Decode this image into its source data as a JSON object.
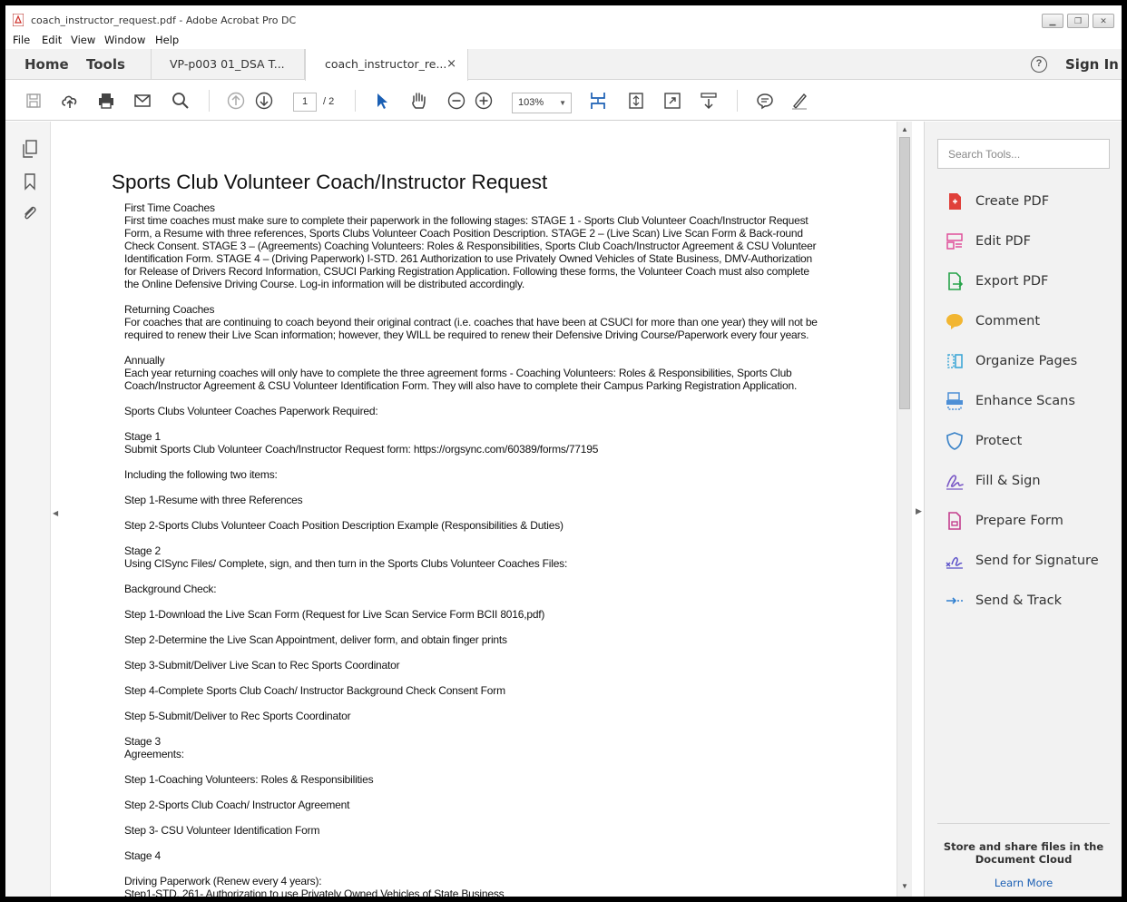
{
  "window": {
    "title": "coach_instructor_request.pdf - Adobe Acrobat Pro DC"
  },
  "menu": [
    "File",
    "Edit",
    "View",
    "Window",
    "Help"
  ],
  "tabs": {
    "home": "Home",
    "tools": "Tools",
    "docs": [
      {
        "label": "VP-p003 01_DSA T..."
      },
      {
        "label": "coach_instructor_re...",
        "close": "×"
      }
    ],
    "sign_in": "Sign In",
    "help": "?"
  },
  "toolbar": {
    "page_current": "1",
    "page_total": "/ 2",
    "zoom": "103%",
    "zoom_caret": "▼"
  },
  "document": {
    "title": "Sports Club Volunteer Coach/Instructor Request",
    "paragraphs": [
      [
        "First Time Coaches",
        "First time coaches must make sure to complete their paperwork in the following stages: STAGE 1 - Sports Club Volunteer Coach/Instructor Request",
        "Form, a Resume with three references, Sports Clubs Volunteer Coach Position Description.  STAGE 2 – (Live Scan) Live Scan Form & Back-round",
        "Check Consent.  STAGE 3 – (Agreements) Coaching Volunteers: Roles & Responsibilities, Sports Club Coach/Instructor Agreement & CSU Volunteer",
        "Identification Form.  STAGE 4 – (Driving Paperwork) I-STD. 261 Authorization to use Privately Owned Vehicles of State Business, DMV-Authorization",
        "for Release of Drivers Record Information, CSUCI Parking Registration Application.  Following these forms, the Volunteer Coach must also complete",
        "the Online Defensive Driving Course.  Log-in information will be distributed accordingly."
      ],
      [
        "Returning Coaches",
        "For coaches that are continuing to coach beyond their original contract (i.e. coaches that have been at CSUCI for more than one year) they will not be",
        "required to renew their Live Scan information; however, they WILL be required to renew their Defensive Driving Course/Paperwork every four years."
      ],
      [
        "Annually",
        "Each year returning coaches will only have to complete the three agreement forms -   Coaching Volunteers: Roles & Responsibilities, Sports Club",
        "Coach/Instructor Agreement & CSU Volunteer Identification Form.  They will also have to complete their Campus Parking Registration Application."
      ],
      [
        "Sports Clubs Volunteer Coaches Paperwork Required:"
      ],
      [
        "Stage 1",
        "Submit Sports Club Volunteer Coach/Instructor Request form: https://orgsync.com/60389/forms/77195"
      ],
      [
        "Including the following two items:"
      ],
      [
        "Step 1-Resume with three References"
      ],
      [
        "Step 2-Sports Clubs Volunteer Coach Position Description Example (Responsibilities & Duties)"
      ],
      [
        "Stage 2",
        "Using CISync Files/ Complete, sign, and then turn in the Sports Clubs Volunteer Coaches Files:"
      ],
      [
        "Background Check:"
      ],
      [
        "Step 1-Download the Live Scan Form (Request for Live Scan Service Form BCII 8016,pdf)"
      ],
      [
        "Step 2-Determine the Live Scan Appointment, deliver form, and obtain finger prints"
      ],
      [
        "Step 3-Submit/Deliver Live Scan to Rec Sports Coordinator"
      ],
      [
        "Step 4-Complete Sports Club Coach/ Instructor Background Check Consent Form"
      ],
      [
        "Step 5-Submit/Deliver to Rec Sports Coordinator"
      ],
      [
        "Stage 3",
        "Agreements:"
      ],
      [
        "Step 1-Coaching Volunteers: Roles & Responsibilities"
      ],
      [
        "Step 2-Sports Club Coach/ Instructor Agreement"
      ],
      [
        "Step 3- CSU Volunteer Identification Form"
      ],
      [
        "Stage 4"
      ],
      [
        "Driving Paperwork (Renew every 4 years):",
        "Step1-STD. 261- Authorization to use Privately Owned Vehicles of State Business"
      ]
    ]
  },
  "tools_pane": {
    "search_placeholder": "Search Tools...",
    "items": [
      {
        "label": "Create PDF",
        "icon": "create-pdf-icon",
        "color": "#e0403a"
      },
      {
        "label": "Edit PDF",
        "icon": "edit-pdf-icon",
        "color": "#e0509a"
      },
      {
        "label": "Export PDF",
        "icon": "export-pdf-icon",
        "color": "#27a34a"
      },
      {
        "label": "Comment",
        "icon": "comment-icon",
        "color": "#f2b632"
      },
      {
        "label": "Organize Pages",
        "icon": "organize-pages-icon",
        "color": "#3fa7d6"
      },
      {
        "label": "Enhance Scans",
        "icon": "enhance-scans-icon",
        "color": "#4d8fd6"
      },
      {
        "label": "Protect",
        "icon": "protect-icon",
        "color": "#3f86c9"
      },
      {
        "label": "Fill & Sign",
        "icon": "fill-sign-icon",
        "color": "#7a58c6"
      },
      {
        "label": "Prepare Form",
        "icon": "prepare-form-icon",
        "color": "#c43f8e"
      },
      {
        "label": "Send for Signature",
        "icon": "send-for-signature-icon",
        "color": "#5a4fc9"
      },
      {
        "label": "Send & Track",
        "icon": "send-track-icon",
        "color": "#2f7fd0"
      }
    ],
    "store_text": "Store and share files in the Document Cloud",
    "learn_more": "Learn More"
  }
}
